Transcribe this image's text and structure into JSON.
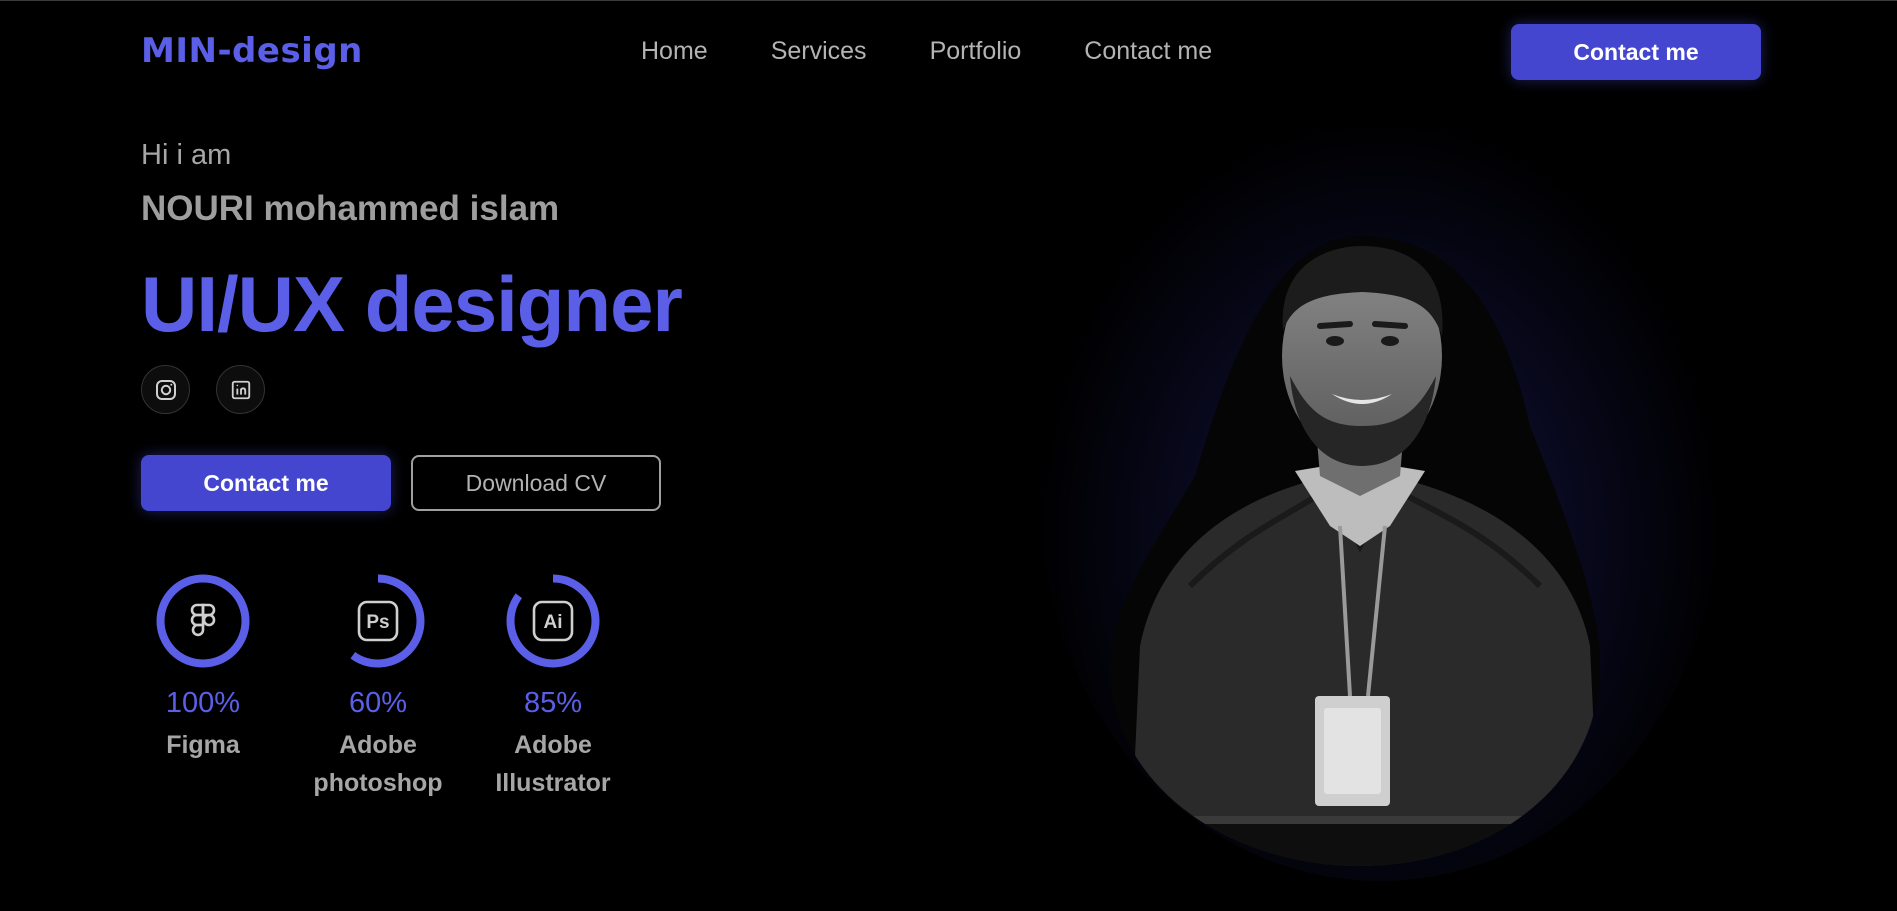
{
  "nav": {
    "logo": "MIN-design",
    "links": [
      "Home",
      "Services",
      "Portfolio",
      "Contact me"
    ],
    "cta_label": "Contact me"
  },
  "hero": {
    "greeting": "Hi i am",
    "name": "NOURI mohammed islam",
    "role": "UI/UX designer",
    "social": [
      "instagram-icon",
      "linkedin-icon"
    ],
    "primary_button": "Contact me",
    "secondary_button": "Download CV"
  },
  "skills": [
    {
      "icon": "figma-icon",
      "percent": 100,
      "percent_label": "100%",
      "name_lines": [
        "Figma"
      ]
    },
    {
      "icon": "photoshop-icon",
      "percent": 60,
      "percent_label": "60%",
      "name_lines": [
        "Adobe",
        "photoshop"
      ]
    },
    {
      "icon": "illustrator-icon",
      "percent": 85,
      "percent_label": "85%",
      "name_lines": [
        "Adobe",
        "Illustrator"
      ]
    }
  ],
  "colors": {
    "accent": "#5b5fe8",
    "button": "#4446d0",
    "background": "#000000",
    "text": "#b3b3b3"
  }
}
